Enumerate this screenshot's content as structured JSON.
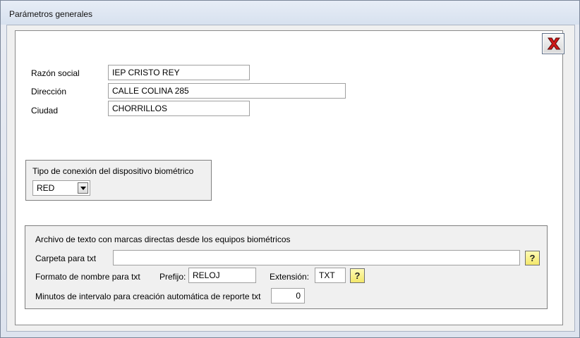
{
  "window": {
    "title": "Parámetros generales"
  },
  "general": {
    "razon_social_label": "Razón social",
    "razon_social_value": "IEP CRISTO REY",
    "direccion_label": "Dirección",
    "direccion_value": "CALLE COLINA 285",
    "ciudad_label": "Ciudad",
    "ciudad_value": "CHORRILLOS"
  },
  "biometric": {
    "group_title": "Tipo de conexión del dispositivo biométrico",
    "connection_value": "RED"
  },
  "txt_file": {
    "group_title": "Archivo de texto con marcas directas desde los equipos biométricos",
    "folder_label": "Carpeta para txt",
    "folder_value": "",
    "format_label": "Formato de nombre para txt",
    "prefix_label": "Prefijo:",
    "prefix_value": "RELOJ",
    "extension_label": "Extensión:",
    "extension_value": "TXT",
    "interval_label": "Minutos de intervalo para creación automática de reporte txt",
    "interval_value": "0",
    "help_glyph": "?"
  },
  "icons": {
    "close": "close-red-x-icon",
    "dropdown": "chevron-down-icon",
    "help": "help-question-icon"
  },
  "colors": {
    "help_button": "#f3e76a",
    "close_x": "#d01818"
  }
}
